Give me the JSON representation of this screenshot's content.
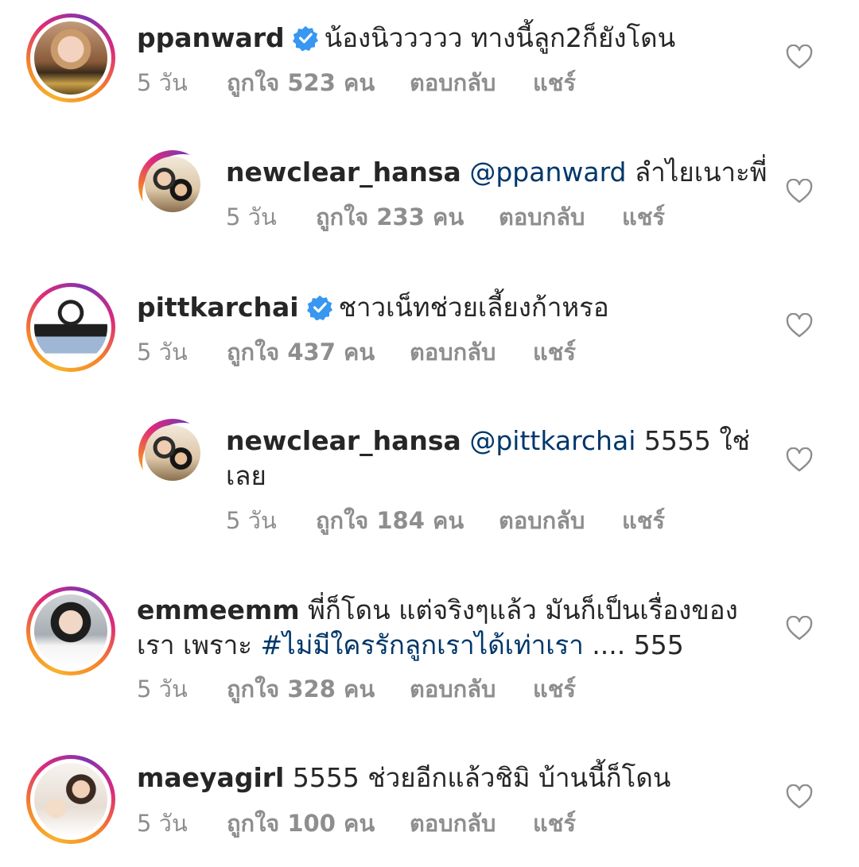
{
  "comments": [
    {
      "username": "ppanward",
      "verified": true,
      "text": "น้องนิววววว ทางนี้ลูก2ก็ยังโดน",
      "time": "5 วัน",
      "likes": "ถูกใจ 523 คน",
      "reply": "ตอบกลับ",
      "share": "แชร์"
    },
    {
      "username": "newclear_hansa",
      "verified": false,
      "mention": "@ppanward",
      "text": " ลำไยเนาะพี่",
      "time": "5 วัน",
      "likes": "ถูกใจ 233 คน",
      "reply": "ตอบกลับ",
      "share": "แชร์"
    },
    {
      "username": "pittkarchai",
      "verified": true,
      "text": "ชาวเน็ทช่วยเลี้ยงก้าหรอ",
      "time": "5 วัน",
      "likes": "ถูกใจ 437 คน",
      "reply": "ตอบกลับ",
      "share": "แชร์"
    },
    {
      "username": "newclear_hansa",
      "verified": false,
      "mention": "@pittkarchai",
      "text": " 5555 ใช่",
      "text2": "เลย",
      "time": "5 วัน",
      "likes": "ถูกใจ 184 คน",
      "reply": "ตอบกลับ",
      "share": "แชร์"
    },
    {
      "username": "emmeemm",
      "verified": false,
      "text": " พี่ก็โดน แต่จริงๆแล้ว มันก็เป็นเรื่องของ",
      "text2_pre": "เรา เพราะ ",
      "hashtag": "#ไม่มีใครรักลูกเราได้เท่าเรา",
      "text2_post": " .... 555",
      "time": "5 วัน",
      "likes": "ถูกใจ 328 คน",
      "reply": "ตอบกลับ",
      "share": "แชร์"
    },
    {
      "username": "maeyagirl",
      "verified": false,
      "text": " 5555 ช่วยอีกแล้วชิมิ บ้านนี้ก็โดน",
      "time": "5 วัน",
      "likes": "ถูกใจ 100 คน",
      "reply": "ตอบกลับ",
      "share": "แชร์"
    }
  ],
  "colors": {
    "text": "#262626",
    "meta": "#8e8e8e",
    "link": "#00376b",
    "verified": "#3897f0"
  }
}
